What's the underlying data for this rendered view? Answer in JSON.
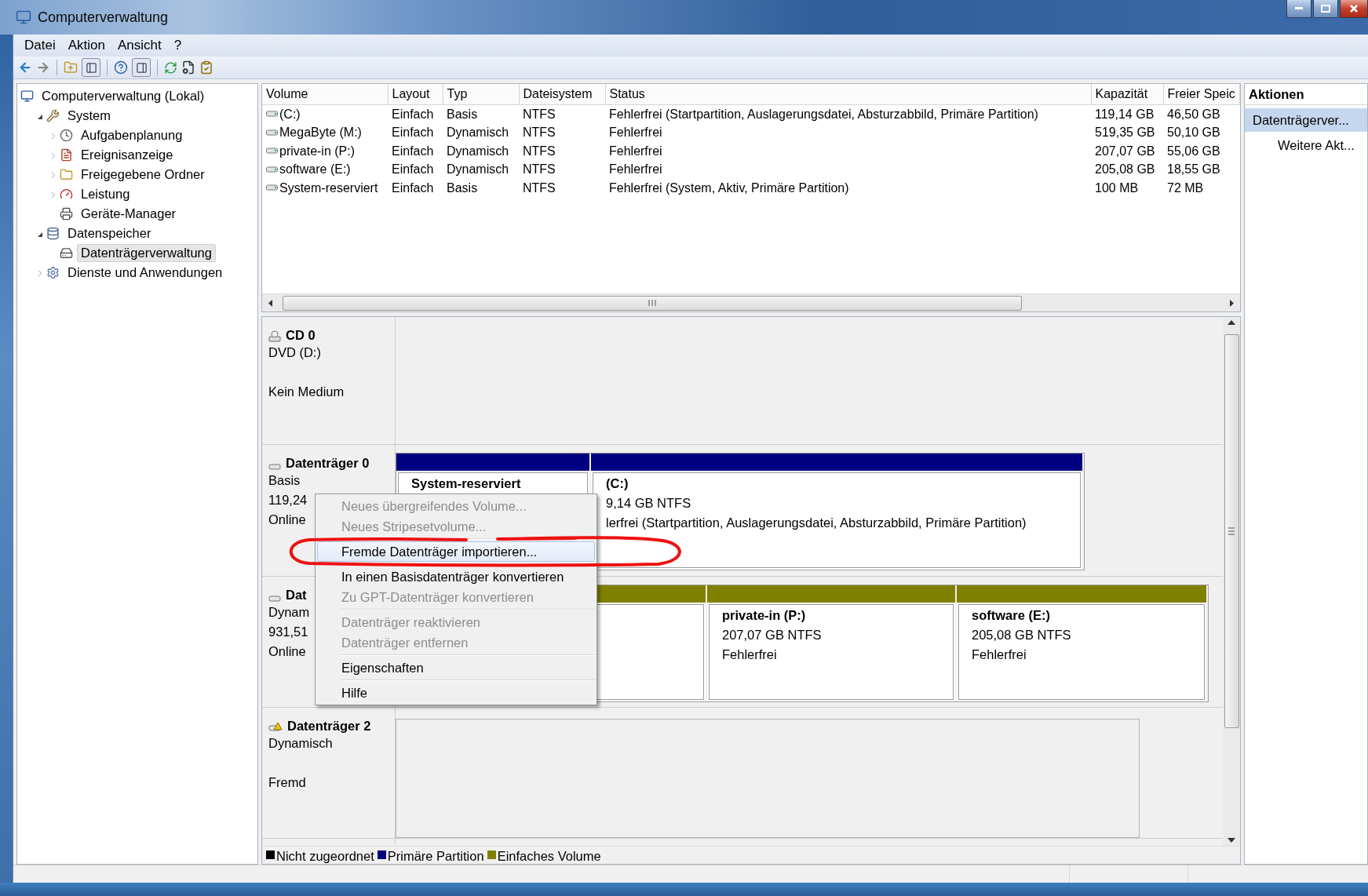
{
  "window": {
    "title": "Computerverwaltung"
  },
  "menu": [
    {
      "label": "Datei"
    },
    {
      "label": "Aktion"
    },
    {
      "label": "Ansicht"
    },
    {
      "label": "?"
    }
  ],
  "tree": {
    "label": "Computerverwaltung (Lokal)",
    "selected": false,
    "children": [
      {
        "label": "System",
        "kind": "folder",
        "expanded": true,
        "selected": false,
        "children": [
          {
            "label": "Aufgabenplanung",
            "kind": "folder",
            "expanded": false,
            "selected": false
          },
          {
            "label": "Ereignisanzeige",
            "kind": "folder",
            "expanded": false,
            "selected": false
          },
          {
            "label": "Freigegebene Ordner",
            "kind": "folder",
            "expanded": false,
            "selected": false
          },
          {
            "label": "Leistung",
            "kind": "folder",
            "expanded": false,
            "selected": false
          },
          {
            "label": "Geräte-Manager",
            "kind": "leaf",
            "selected": false
          }
        ]
      },
      {
        "label": "Datenspeicher",
        "kind": "folder",
        "expanded": true,
        "selected": false,
        "children": [
          {
            "label": "Datenträgerverwaltung",
            "kind": "leaf",
            "selected": true
          }
        ]
      },
      {
        "label": "Dienste und Anwendungen",
        "kind": "folder",
        "expanded": false,
        "selected": false
      }
    ]
  },
  "volumes": {
    "columns": [
      "Volume",
      "Layout",
      "Typ",
      "Dateisystem",
      "Status",
      "Kapazität",
      "Freier Speic"
    ],
    "rows": [
      [
        "(C:)",
        "Einfach",
        "Basis",
        "NTFS",
        "Fehlerfrei (Startpartition, Auslagerungsdatei, Absturzabbild, Primäre Partition)",
        "119,14 GB",
        "46,50 GB"
      ],
      [
        "MegaByte (M:)",
        "Einfach",
        "Dynamisch",
        "NTFS",
        "Fehlerfrei",
        "519,35 GB",
        "50,10 GB"
      ],
      [
        "private-in (P:)",
        "Einfach",
        "Dynamisch",
        "NTFS",
        "Fehlerfrei",
        "207,07 GB",
        "55,06 GB"
      ],
      [
        "software (E:)",
        "Einfach",
        "Dynamisch",
        "NTFS",
        "Fehlerfrei",
        "205,08 GB",
        "18,55 GB"
      ],
      [
        "System-reserviert",
        "Einfach",
        "Basis",
        "NTFS",
        "Fehlerfrei (System, Aktiv, Primäre Partition)",
        "100 MB",
        "72 MB"
      ]
    ]
  },
  "disks": [
    {
      "kind": "cdrom",
      "name": "CD 0",
      "type": "DVD (D:)",
      "status": "Kein Medium"
    },
    {
      "kind": "basic",
      "name": "Datenträger 0",
      "type": "Basis",
      "size": "119,24",
      "status": "Online",
      "partitions": [
        {
          "kind": "primary",
          "title": "System-reserviert"
        },
        {
          "kind": "primary",
          "title": "(C:)",
          "size": "9,14 GB NTFS",
          "status": "lerfrei (Startpartition, Auslagerungsdatei, Absturzabbild, Primäre Partition)"
        }
      ]
    },
    {
      "kind": "dynamic",
      "name": "Dat",
      "type": "Dynam",
      "size": "931,51",
      "status": "Online",
      "partitions": [
        {
          "kind": "simple"
        },
        {
          "kind": "simple",
          "title": "private-in  (P:)",
          "size": "207,07 GB NTFS",
          "status": "Fehlerfrei"
        },
        {
          "kind": "simple",
          "title": "software  (E:)",
          "size": "205,08 GB NTFS",
          "status": "Fehlerfrei"
        }
      ]
    },
    {
      "kind": "foreign",
      "name": "Datenträger 2",
      "type": "Dynamisch",
      "status": "Fremd"
    }
  ],
  "legend": [
    {
      "label": "Nicht zugeordnet",
      "color": "#000000"
    },
    {
      "label": "Primäre Partition",
      "color": "#000080"
    },
    {
      "label": "Einfaches Volume",
      "color": "#808000"
    }
  ],
  "context_menu": [
    {
      "kind": "item",
      "label": "Neues übergreifendes Volume...",
      "disabled": true,
      "selected": false
    },
    {
      "kind": "item",
      "label": "Neues Stripesetvolume...",
      "disabled": true,
      "selected": false
    },
    {
      "kind": "separator"
    },
    {
      "kind": "item",
      "label": "Fremde Datenträger importieren...",
      "disabled": false,
      "selected": true
    },
    {
      "kind": "separator"
    },
    {
      "kind": "item",
      "label": "In einen Basisdatenträger konvertieren",
      "disabled": false,
      "selected": false
    },
    {
      "kind": "item",
      "label": "Zu GPT-Datenträger konvertieren",
      "disabled": true,
      "selected": false
    },
    {
      "kind": "separator"
    },
    {
      "kind": "item",
      "label": "Datenträger reaktivieren",
      "disabled": true,
      "selected": false
    },
    {
      "kind": "item",
      "label": "Datenträger entfernen",
      "disabled": true,
      "selected": false
    },
    {
      "kind": "separator"
    },
    {
      "kind": "item",
      "label": "Eigenschaften",
      "disabled": false,
      "selected": false
    },
    {
      "kind": "separator"
    },
    {
      "kind": "item",
      "label": "Hilfe",
      "disabled": false,
      "selected": false
    }
  ],
  "actions": {
    "title": "Aktionen",
    "items": [
      {
        "kind": "group",
        "label": "Datenträgerver...",
        "selected": true
      },
      {
        "kind": "sub",
        "label": "Weitere Akt...",
        "selected": false
      }
    ]
  }
}
